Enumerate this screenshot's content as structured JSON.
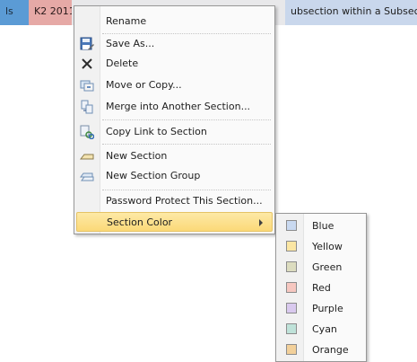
{
  "tabs": [
    {
      "label": "ls"
    },
    {
      "label": "K2 2011"
    },
    {
      "label": ""
    },
    {
      "label": "ubsection within a Subsecti"
    }
  ],
  "context_menu": {
    "items": [
      {
        "label": "Rename",
        "icon": "none"
      },
      {
        "label": "Save As...",
        "icon": "save-as-icon"
      },
      {
        "label": "Delete",
        "icon": "delete-x-icon"
      },
      {
        "label": "Move or Copy...",
        "icon": "move-copy-icon"
      },
      {
        "label": "Merge into Another Section...",
        "icon": "merge-icon"
      },
      {
        "label": "Copy Link to Section",
        "icon": "link-icon"
      },
      {
        "label": "New Section",
        "icon": "new-section-icon"
      },
      {
        "label": "New Section Group",
        "icon": "new-section-group-icon"
      },
      {
        "label": "Password Protect This Section...",
        "icon": "none"
      },
      {
        "label": "Section Color",
        "icon": "none",
        "highlighted": true,
        "has_submenu": true
      }
    ]
  },
  "color_submenu": {
    "items": [
      {
        "label": "Blue",
        "swatch": "#c9d9f0"
      },
      {
        "label": "Yellow",
        "swatch": "#fbe6a3"
      },
      {
        "label": "Green",
        "swatch": "#dcdcbf"
      },
      {
        "label": "Red",
        "swatch": "#f6c7c0"
      },
      {
        "label": "Purple",
        "swatch": "#d9c9ee"
      },
      {
        "label": "Cyan",
        "swatch": "#bfe2d9"
      },
      {
        "label": "Orange",
        "swatch": "#f2d09a"
      }
    ]
  },
  "colors": {
    "highlight": "#fbd978",
    "menu_bg": "#fafafa",
    "border": "#979797"
  }
}
